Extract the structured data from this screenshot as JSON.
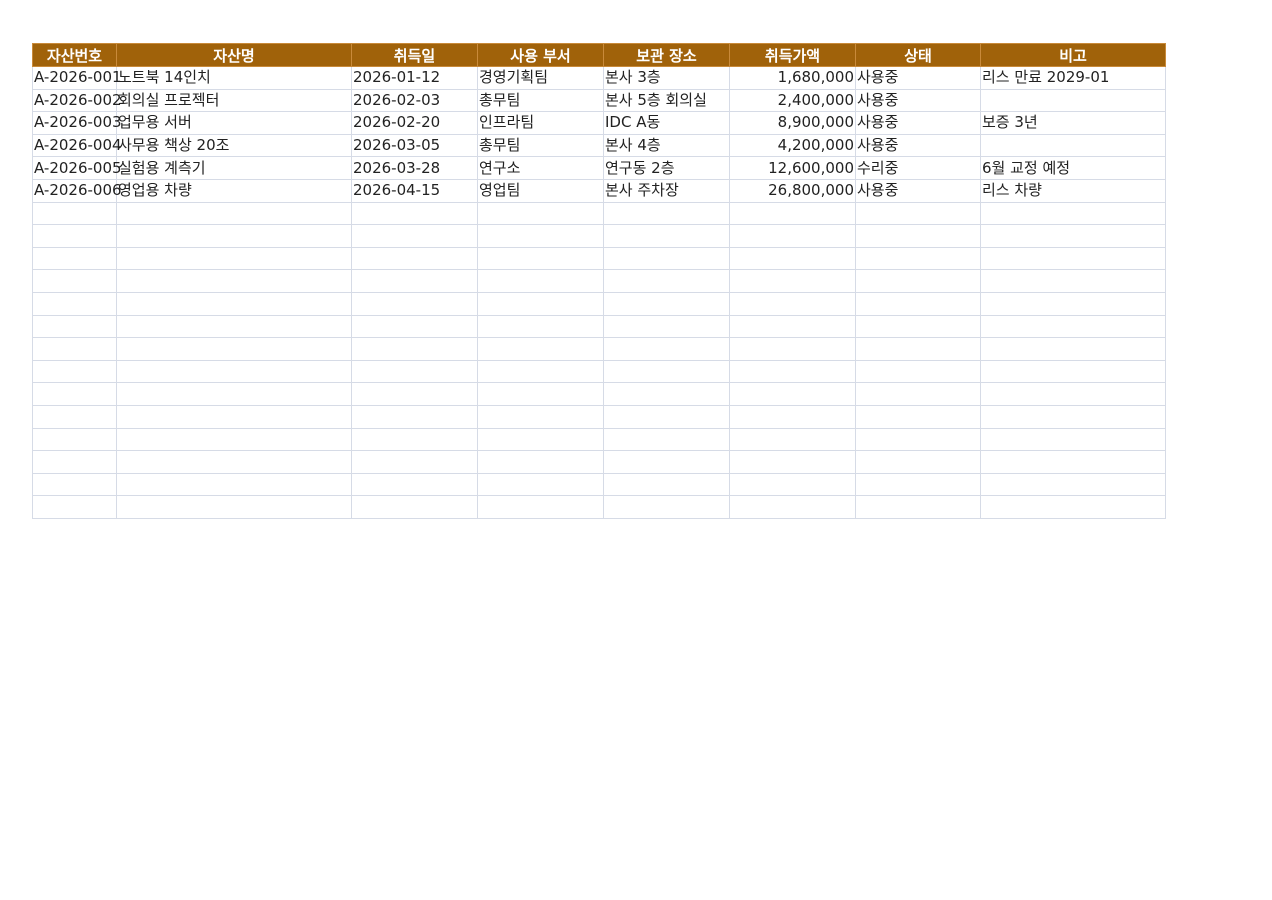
{
  "sheet": {
    "headers": [
      "자산번호",
      "자산명",
      "취득일",
      "사용 부서",
      "보관 장소",
      "취득가액",
      "상태",
      "비고"
    ],
    "rows": [
      [
        "A-2026-001",
        "노트북 14인치",
        "2026-01-12",
        "경영기획팀",
        "본사 3층",
        "1,680,000",
        "사용중",
        "리스 만료 2029-01"
      ],
      [
        "A-2026-002",
        "회의실 프로젝터",
        "2026-02-03",
        "총무팀",
        "본사 5층 회의실",
        "2,400,000",
        "사용중",
        ""
      ],
      [
        "A-2026-003",
        "업무용 서버",
        "2026-02-20",
        "인프라팀",
        "IDC A동",
        "8,900,000",
        "사용중",
        "보증 3년"
      ],
      [
        "A-2026-004",
        "사무용 책상 20조",
        "2026-03-05",
        "총무팀",
        "본사 4층",
        "4,200,000",
        "사용중",
        ""
      ],
      [
        "A-2026-005",
        "실험용 계측기",
        "2026-03-28",
        "연구소",
        "연구동 2층",
        "12,600,000",
        "수리중",
        "6월 교정 예정"
      ],
      [
        "A-2026-006",
        "영업용 차량",
        "2026-04-15",
        "영업팀",
        "본사 주차장",
        "26,800,000",
        "사용중",
        "리스 차량"
      ]
    ]
  },
  "colors": {
    "header_bg": "#a0620a",
    "header_text": "#ffffff",
    "grid": "#d6dbe6"
  }
}
